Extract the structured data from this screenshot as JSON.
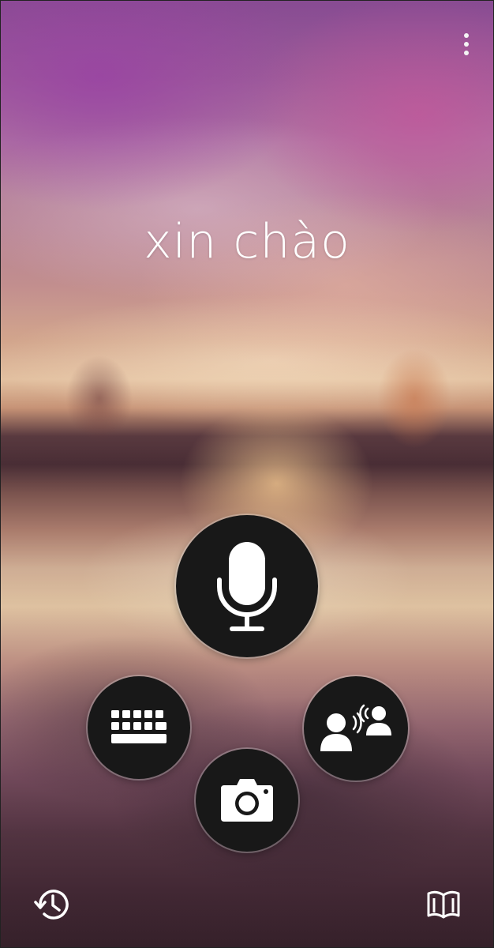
{
  "header": {
    "menu_icon": "more-vert-icon"
  },
  "translation": {
    "text": "xin chào",
    "color": "#ffffff"
  },
  "controls": {
    "mic_icon": "microphone-icon",
    "keyboard_icon": "keyboard-icon",
    "camera_icon": "camera-icon",
    "conversation_icon": "conversation-icon",
    "button_color": "#181818"
  },
  "footer": {
    "history_icon": "history-icon",
    "phrasebook_icon": "phrasebook-icon"
  }
}
